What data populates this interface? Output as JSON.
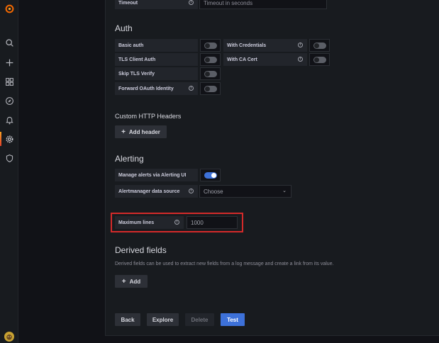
{
  "sidebar": {
    "icons": [
      "grafana-logo-icon",
      "search-icon",
      "plus-icon",
      "dashboards-icon",
      "explore-icon",
      "alerting-bell-icon",
      "gear-icon",
      "shield-icon"
    ]
  },
  "http": {
    "timeout_label": "Timeout",
    "timeout_placeholder": "Timeout in seconds"
  },
  "auth": {
    "title": "Auth",
    "basic_auth": "Basic auth",
    "with_credentials": "With Credentials",
    "tls_client_auth": "TLS Client Auth",
    "with_ca_cert": "With CA Cert",
    "skip_tls_verify": "Skip TLS Verify",
    "forward_oauth": "Forward OAuth Identity"
  },
  "custom_headers": {
    "title": "Custom HTTP Headers",
    "add_header": "Add header"
  },
  "alerting": {
    "title": "Alerting",
    "manage_alerts": "Manage alerts via Alerting UI",
    "manage_alerts_on": true,
    "alertmanager_label": "Alertmanager data source",
    "alertmanager_value": "Choose"
  },
  "max_lines": {
    "label": "Maximum lines",
    "value": "1000"
  },
  "derived_fields": {
    "title": "Derived fields",
    "description": "Derived fields can be used to extract new fields from a log message and create a link from its value.",
    "add": "Add"
  },
  "actions": {
    "back": "Back",
    "explore": "Explore",
    "delete": "Delete",
    "test": "Test"
  },
  "colors": {
    "accent": "#3d71d9",
    "highlight": "#d42a2a"
  }
}
